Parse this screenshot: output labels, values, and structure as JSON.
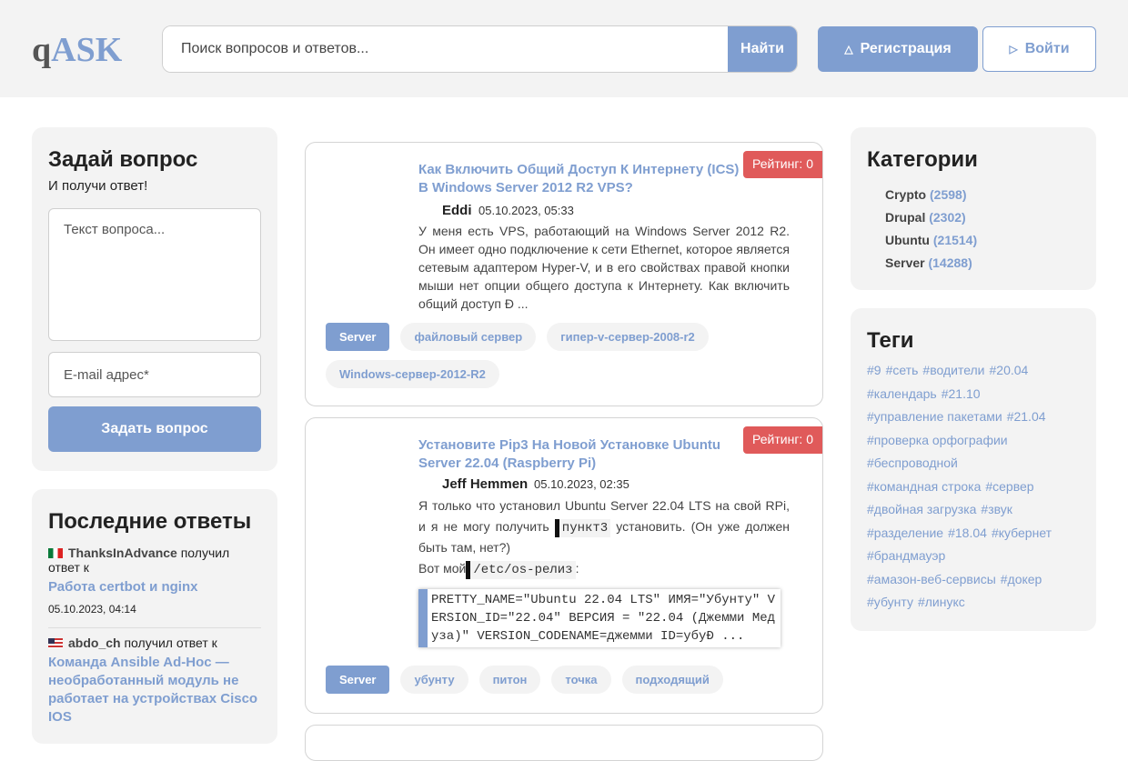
{
  "header": {
    "logo_q": "q",
    "logo_ask": "ASK",
    "search_placeholder": "Поиск вопросов и ответов...",
    "search_button": "Найти",
    "register_label": "Регистрация",
    "login_label": "Войти",
    "register_icon": "user-plus-icon",
    "login_icon": "sign-in-icon"
  },
  "ask": {
    "title": "Задай вопрос",
    "subtitle": "И получи ответ!",
    "question_placeholder": "Текст вопроса...",
    "email_placeholder": "E-mail адрес*",
    "submit_label": "Задать вопрос"
  },
  "recent_answers": {
    "title": "Последние ответы",
    "items": [
      {
        "flag": "mx",
        "user": "ThanksInAdvance",
        "action": "получил ответ к",
        "link": "Работа certbot и nginx",
        "date": "05.10.2023, 04:14"
      },
      {
        "flag": "us",
        "user": "abdo_ch",
        "action": "получил ответ к",
        "link": "Команда Ansible Ad-Hoc — необработанный модуль не работает на устройствах Cisco IOS",
        "date": ""
      }
    ]
  },
  "posts": [
    {
      "rating": "Рейтинг: 0",
      "title": "Как Включить Общий Доступ К Интернету (ICS) В Windows Server 2012 R2 VPS?",
      "author": "Eddi",
      "date": "05.10.2023, 05:33",
      "body": "У меня есть VPS, работающий на Windows Server 2012 R2. Он имеет одно подключение к сети Ethernet, которое является сетевым адаптером Hyper-V, и в его свойствах правой кнопки мыши нет опции общего доступа к Интернету. Как включить общий доступ Ð ...",
      "tags": [
        "Server",
        "файловый сервер",
        "гипер-v-сервер-2008-r2",
        "Windows-сервер-2012-R2"
      ]
    },
    {
      "rating": "Рейтинг: 0",
      "title": "Установите Pip3 На Новой Установке Ubuntu Server 22.04 (Raspberry Pi)",
      "author": "Jeff Hemmen",
      "date": "05.10.2023, 02:35",
      "body_part1": "Я только что установил Ubuntu Server 22.04 LTS на свой RPi, и я не могу получить",
      "code1": "пункт3",
      "body_part2": "установить. (Он уже должен быть там, нет?)",
      "body_part3": "Вот мой",
      "code2": "/etc/os-релиз",
      "body_part4": ":",
      "code_block": "PRETTY_NAME=\"Ubuntu 22.04 LTS\" ИМЯ=\"Убунту\" VERSION_ID=\"22.04\" ВЕРСИЯ = \"22.04 (Джемми Медуза)\" VERSION_CODENAME=джемми ID=убуÐ ...",
      "tags": [
        "Server",
        "убунту",
        "питон",
        "точка",
        "подходящий"
      ]
    }
  ],
  "categories": {
    "title": "Категории",
    "items": [
      {
        "name": "Crypto",
        "count": "(2598)"
      },
      {
        "name": "Drupal",
        "count": "(2302)"
      },
      {
        "name": "Ubuntu",
        "count": "(21514)"
      },
      {
        "name": "Server",
        "count": "(14288)"
      }
    ]
  },
  "tags_panel": {
    "title": "Теги",
    "items": [
      "#9",
      "#сеть",
      "#водители",
      "#20.04",
      "#календарь",
      "#21.10",
      "#управление пакетами",
      "#21.04",
      "#проверка орфографии",
      "#беспроводной",
      "#командная строка",
      "#сервер",
      "#двойная загрузка",
      "#звук",
      "#разделение",
      "#18.04",
      "#кубернет",
      "#брандмауэр",
      "#амазон-веб-сервисы",
      "#докер",
      "#убунту",
      "#линукс"
    ]
  },
  "colors": {
    "accent": "#7f9ed0",
    "rating_bg": "#e05a5a",
    "panel_bg": "#f3f3f3"
  }
}
